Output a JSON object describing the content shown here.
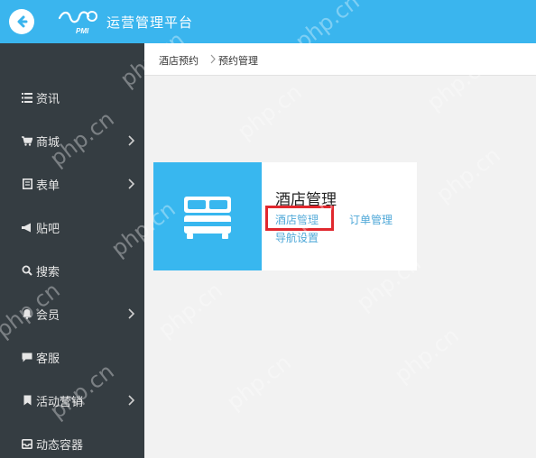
{
  "header": {
    "title": "运营管理平台",
    "logo_text": "PMI"
  },
  "sidebar": {
    "items": [
      {
        "label": "资讯",
        "icon": "list-icon",
        "has_submenu": false
      },
      {
        "label": "商城",
        "icon": "cart-icon",
        "has_submenu": true
      },
      {
        "label": "表单",
        "icon": "form-icon",
        "has_submenu": true
      },
      {
        "label": "贴吧",
        "icon": "megaphone-icon",
        "has_submenu": false
      },
      {
        "label": "搜索",
        "icon": "search-icon",
        "has_submenu": false
      },
      {
        "label": "会员",
        "icon": "bell-icon",
        "has_submenu": true
      },
      {
        "label": "客服",
        "icon": "chat-icon",
        "has_submenu": false
      },
      {
        "label": "活动营销",
        "icon": "bookmark-icon",
        "has_submenu": true
      },
      {
        "label": "动态容器",
        "icon": "inbox-icon",
        "has_submenu": false
      }
    ]
  },
  "breadcrumb": {
    "items": [
      "酒店预约",
      "预约管理"
    ]
  },
  "module_card": {
    "title": "酒店管理",
    "icon": "bed-icon",
    "links": [
      "酒店管理",
      "订单管理",
      "导航设置"
    ]
  },
  "watermark": {
    "text": "php.cn"
  },
  "colors": {
    "topbar": "#3ab5ee",
    "sidebar": "#353d42",
    "accent": "#38b7ef",
    "highlight": "#e0282e",
    "link": "#4fa8d8"
  }
}
